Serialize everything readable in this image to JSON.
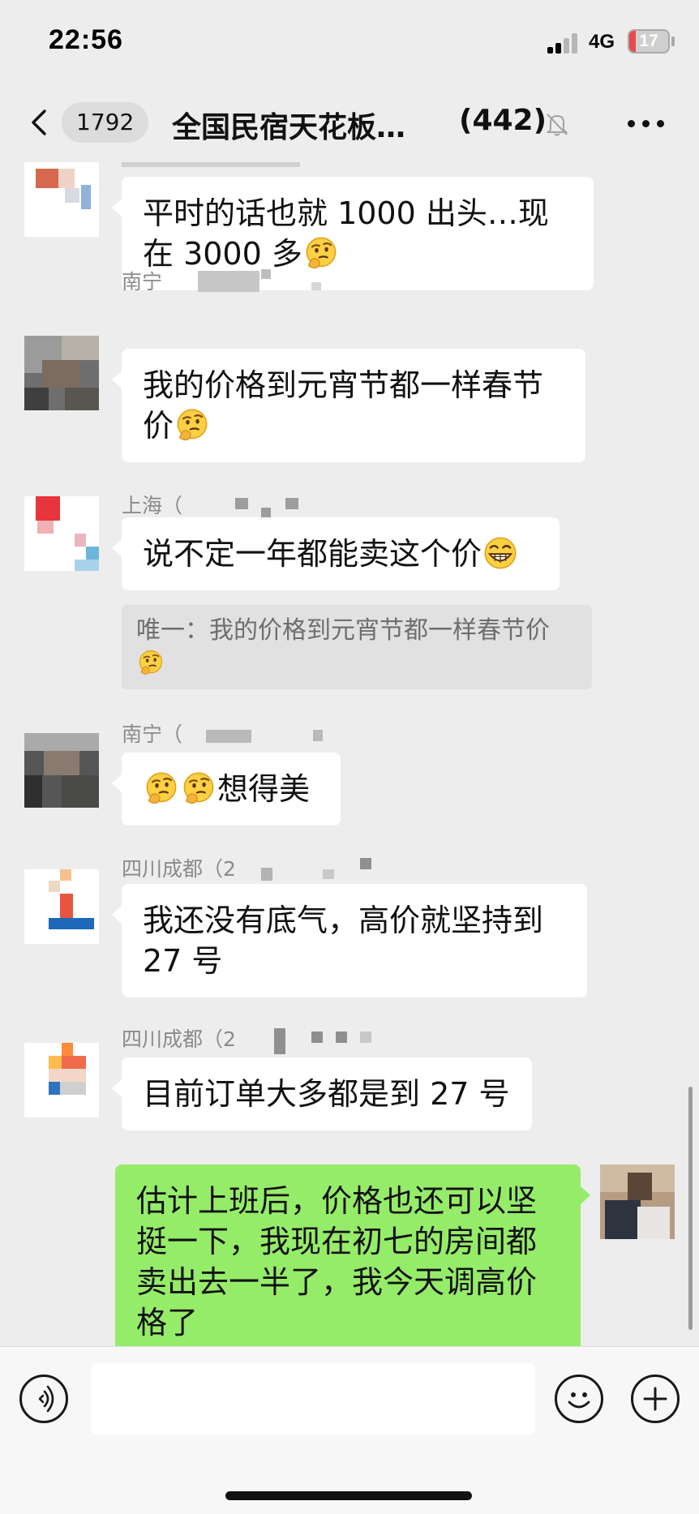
{
  "status_bar": {
    "time": "22:56",
    "network": "4G",
    "battery": "17",
    "battery_level_percent": 17,
    "battery_color": "#e84a4a"
  },
  "header": {
    "back_icon": "chevron-left-icon",
    "unread_count": "1792",
    "title": "全国民宿天花板…",
    "member_count": "(442)",
    "mute_icon": "bell-muted-icon",
    "more_icon": "more-horizontal-icon"
  },
  "messages": [
    {
      "sender": "",
      "text": "平时的话也就 1000 出头…现在 3000 多",
      "emoji": "thinking-face-emoji"
    },
    {
      "sender": "南宁",
      "text": "我的价格到元宵节都一样春节价",
      "emoji": "thinking-face-emoji"
    },
    {
      "sender": "上海（",
      "text": "说不定一年都能卖这个价",
      "emoji": "grinning-face-emoji",
      "quote": {
        "text": "唯一：我的价格到元宵节都一样春节价",
        "emoji": "thinking-face-emoji"
      }
    },
    {
      "sender": "南宁（",
      "text": "想得美",
      "emoji": "thinking-face-emoji"
    },
    {
      "sender": "四川成都（2",
      "text": "我还没有底气，高价就坚持到 27 号"
    },
    {
      "sender": "四川成都（2",
      "text": "目前订单大多都是到 27 号"
    },
    {
      "sender": "me",
      "text": "估计上班后，价格也还可以坚挺一下，我现在初七的房间都卖出去一半了，我今天调高价格了",
      "bubble_color": "#95ec69"
    }
  ],
  "input_bar": {
    "voice_icon": "voice-input-icon",
    "emoji_icon": "emoji-smile-icon",
    "plus_icon": "plus-circle-icon",
    "placeholder": ""
  },
  "colors": {
    "background": "#ededed",
    "my_bubble": "#95ec69",
    "other_bubble": "#ffffff",
    "quote_bg": "#e1e1e1"
  }
}
